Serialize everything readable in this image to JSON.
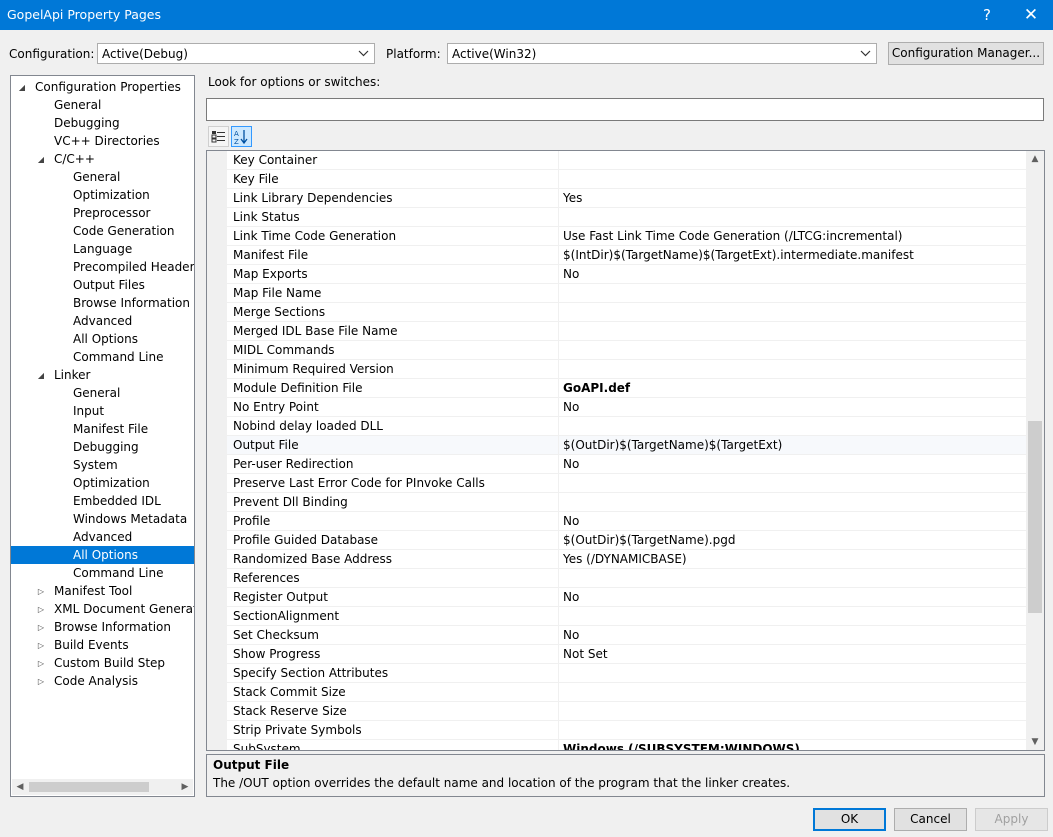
{
  "window": {
    "title": "GopelApi Property Pages",
    "help_glyph": "?",
    "close_glyph": "✕"
  },
  "config": {
    "configuration_label": "Configuration:",
    "configuration_value": "Active(Debug)",
    "platform_label": "Platform:",
    "platform_value": "Active(Win32)",
    "manager_button": "Configuration Manager..."
  },
  "tree": {
    "items": [
      {
        "label": "Configuration Properties",
        "level": 0,
        "expander": "open"
      },
      {
        "label": "General",
        "level": 1
      },
      {
        "label": "Debugging",
        "level": 1
      },
      {
        "label": "VC++ Directories",
        "level": 1
      },
      {
        "label": "C/C++",
        "level": 1,
        "expander": "open"
      },
      {
        "label": "General",
        "level": 2
      },
      {
        "label": "Optimization",
        "level": 2
      },
      {
        "label": "Preprocessor",
        "level": 2
      },
      {
        "label": "Code Generation",
        "level": 2
      },
      {
        "label": "Language",
        "level": 2
      },
      {
        "label": "Precompiled Headers",
        "level": 2
      },
      {
        "label": "Output Files",
        "level": 2
      },
      {
        "label": "Browse Information",
        "level": 2
      },
      {
        "label": "Advanced",
        "level": 2
      },
      {
        "label": "All Options",
        "level": 2
      },
      {
        "label": "Command Line",
        "level": 2
      },
      {
        "label": "Linker",
        "level": 1,
        "expander": "open"
      },
      {
        "label": "General",
        "level": 2
      },
      {
        "label": "Input",
        "level": 2
      },
      {
        "label": "Manifest File",
        "level": 2
      },
      {
        "label": "Debugging",
        "level": 2
      },
      {
        "label": "System",
        "level": 2
      },
      {
        "label": "Optimization",
        "level": 2
      },
      {
        "label": "Embedded IDL",
        "level": 2
      },
      {
        "label": "Windows Metadata",
        "level": 2
      },
      {
        "label": "Advanced",
        "level": 2
      },
      {
        "label": "All Options",
        "level": 2,
        "selected": true
      },
      {
        "label": "Command Line",
        "level": 2
      },
      {
        "label": "Manifest Tool",
        "level": 1,
        "expander": "closed"
      },
      {
        "label": "XML Document Generator",
        "level": 1,
        "expander": "closed"
      },
      {
        "label": "Browse Information",
        "level": 1,
        "expander": "closed"
      },
      {
        "label": "Build Events",
        "level": 1,
        "expander": "closed"
      },
      {
        "label": "Custom Build Step",
        "level": 1,
        "expander": "closed"
      },
      {
        "label": "Code Analysis",
        "level": 1,
        "expander": "closed"
      }
    ]
  },
  "search": {
    "label": "Look for options or switches:",
    "value": ""
  },
  "toolbar": {
    "categorized_icon": "categorized-view-icon",
    "alphabetical_icon": "alphabetical-sort-icon"
  },
  "grid": {
    "rows": [
      {
        "name": "Key Container",
        "value": ""
      },
      {
        "name": "Key File",
        "value": ""
      },
      {
        "name": "Link Library Dependencies",
        "value": "Yes"
      },
      {
        "name": "Link Status",
        "value": ""
      },
      {
        "name": "Link Time Code Generation",
        "value": "Use Fast Link Time Code Generation (/LTCG:incremental)"
      },
      {
        "name": "Manifest File",
        "value": "$(IntDir)$(TargetName)$(TargetExt).intermediate.manifest"
      },
      {
        "name": "Map Exports",
        "value": "No"
      },
      {
        "name": "Map File Name",
        "value": ""
      },
      {
        "name": "Merge Sections",
        "value": ""
      },
      {
        "name": "Merged IDL Base File Name",
        "value": ""
      },
      {
        "name": "MIDL Commands",
        "value": ""
      },
      {
        "name": "Minimum Required Version",
        "value": ""
      },
      {
        "name": "Module Definition File",
        "value": "GoAPI.def",
        "bold": true
      },
      {
        "name": "No Entry Point",
        "value": "No"
      },
      {
        "name": "Nobind delay loaded DLL",
        "value": ""
      },
      {
        "name": "Output File",
        "value": "$(OutDir)$(TargetName)$(TargetExt)",
        "highlight": true
      },
      {
        "name": "Per-user Redirection",
        "value": "No"
      },
      {
        "name": "Preserve Last Error Code for PInvoke Calls",
        "value": ""
      },
      {
        "name": "Prevent Dll Binding",
        "value": ""
      },
      {
        "name": "Profile",
        "value": "No"
      },
      {
        "name": "Profile Guided Database",
        "value": "$(OutDir)$(TargetName).pgd"
      },
      {
        "name": "Randomized Base Address",
        "value": "Yes (/DYNAMICBASE)"
      },
      {
        "name": "References",
        "value": ""
      },
      {
        "name": "Register Output",
        "value": "No"
      },
      {
        "name": "SectionAlignment",
        "value": ""
      },
      {
        "name": "Set Checksum",
        "value": "No"
      },
      {
        "name": "Show Progress",
        "value": "Not Set"
      },
      {
        "name": "Specify Section Attributes",
        "value": ""
      },
      {
        "name": "Stack Commit Size",
        "value": ""
      },
      {
        "name": "Stack Reserve Size",
        "value": ""
      },
      {
        "name": "Strip Private Symbols",
        "value": ""
      },
      {
        "name": "SubSystem",
        "value": "Windows (/SUBSYSTEM:WINDOWS)",
        "bold": true
      }
    ]
  },
  "description": {
    "title": "Output File",
    "text": "The /OUT option overrides the default name and location of the program that the linker creates."
  },
  "buttons": {
    "ok": "OK",
    "cancel": "Cancel",
    "apply": "Apply"
  }
}
